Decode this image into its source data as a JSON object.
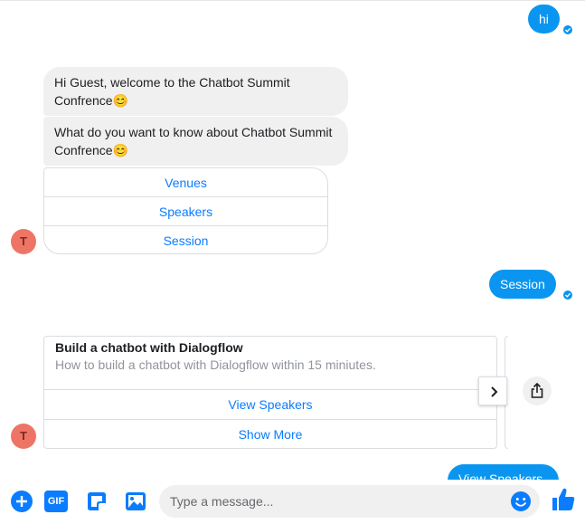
{
  "messages": {
    "user_hi": "hi",
    "bot_welcome": "Hi Guest, welcome to the Chatbot Summit Confrence😊",
    "bot_question": "What do you want to know about Chatbot Summit Confrence😊",
    "user_session": "Session",
    "user_partial": "View Speakers"
  },
  "quick_replies": [
    "Venues",
    "Speakers",
    "Session"
  ],
  "bot_avatar_letter": "T",
  "card": {
    "title": "Build a chatbot with Dialogflow",
    "subtitle": "How to build a chatbot with Dialogflow within 15 miniutes.",
    "buttons": [
      "View Speakers",
      "Show More"
    ]
  },
  "composer": {
    "placeholder": "Type a message...",
    "gif_label": "GIF"
  },
  "colors": {
    "accent": "#0a96f0",
    "link": "#0a7cff",
    "avatar": "#ee7565",
    "bubble_in": "#f0f0f0"
  },
  "icons": [
    "plus-icon",
    "gif-icon",
    "sticker-icon",
    "image-icon",
    "emoji-icon",
    "like-icon",
    "chevron-right-icon",
    "share-icon",
    "seen-check-icon"
  ]
}
